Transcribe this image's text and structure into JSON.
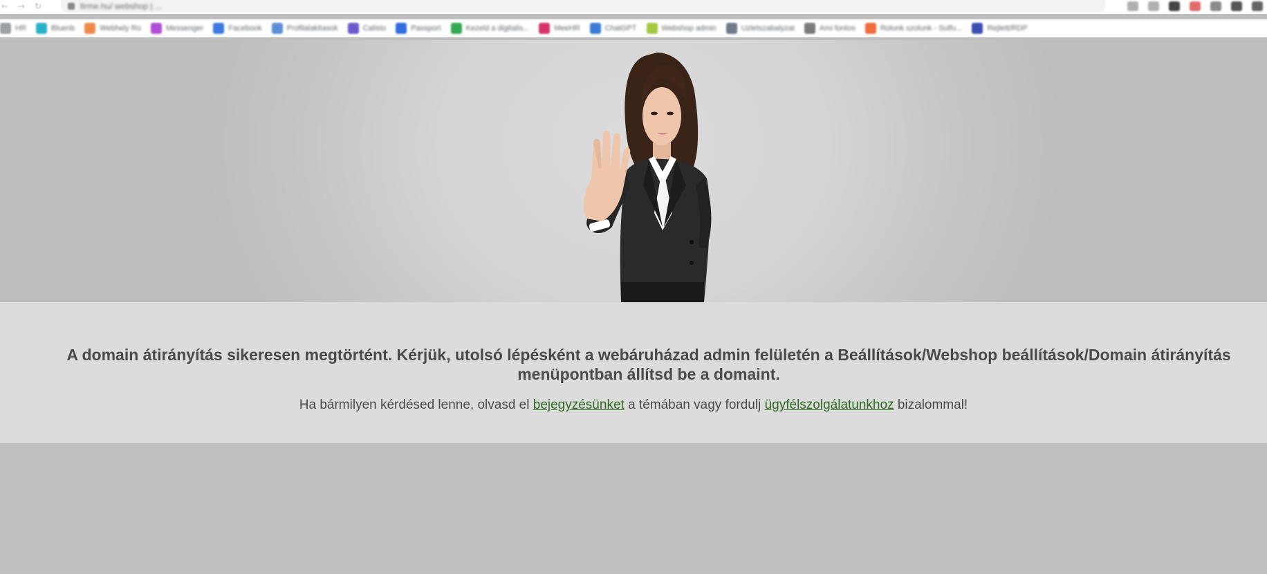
{
  "browser": {
    "address_text": "firme.hu/ webshop | ... ",
    "bookmarks": [
      {
        "label": "HR",
        "color": "#9aa0a6"
      },
      {
        "label": "Bluenb",
        "color": "#2bb0c8"
      },
      {
        "label": "Webhely Ro",
        "color": "#f08a4b"
      },
      {
        "label": "Messenger",
        "color": "#b04fd6"
      },
      {
        "label": "Facebook",
        "color": "#3b7be0"
      },
      {
        "label": "Profilalakitasok",
        "color": "#5b8fd8"
      },
      {
        "label": "Calisto",
        "color": "#6a5acd"
      },
      {
        "label": "Passport",
        "color": "#2f6de1"
      },
      {
        "label": "Kezeld a digitalis...",
        "color": "#34a853"
      },
      {
        "label": "MeeHR",
        "color": "#d6336c"
      },
      {
        "label": "ChatGPT",
        "color": "#3a7bd5"
      },
      {
        "label": "Webshop admin",
        "color": "#a3c940"
      },
      {
        "label": "Uzletszabalyzat",
        "color": "#6f7a8a"
      },
      {
        "label": "Ami fontos",
        "color": "#7b7b7b"
      },
      {
        "label": "Rolunk szolunk - Sulfu...",
        "color": "#ef6c3b"
      },
      {
        "label": "Rejtett/RDP",
        "color": "#3b4fb0"
      }
    ],
    "extension_colors": [
      "#b0b0b0",
      "#b0b0b0",
      "#444444",
      "#e06b6b",
      "#8a8a8a",
      "#555555",
      "#666666"
    ]
  },
  "message": {
    "headline": "A domain átirányítás sikeresen megtörtént. Kérjük, utolsó lépésként a webáruházad admin felületén a Beállítások/Webshop beállítások/Domain átirányítás menüpontban állítsd be a domaint.",
    "sub_prefix": "Ha bármilyen kérdésed lenne, olvasd el ",
    "link_blog": "bejegyzésünket",
    "sub_middle": " a témában vagy fordulj ",
    "link_support": "ügyfélszolgálatunkhoz",
    "sub_suffix": " bizalommal!"
  },
  "colors": {
    "page_background": "#bfbfbf",
    "band_background": "#dcdcdc",
    "text": "#4a4a4a",
    "link": "#2e6b1f"
  }
}
